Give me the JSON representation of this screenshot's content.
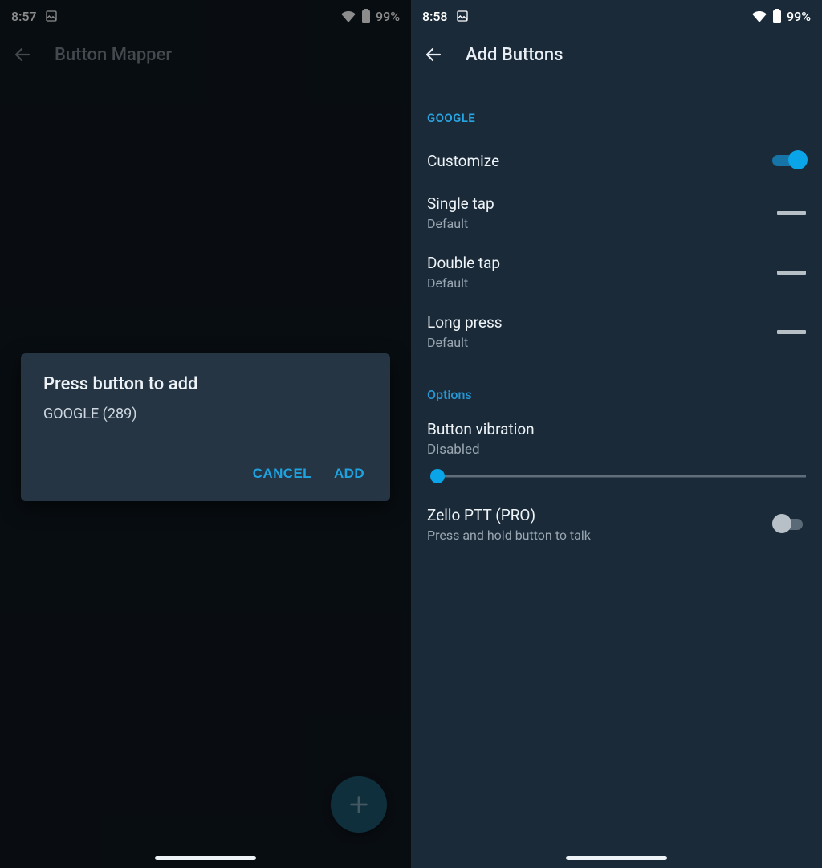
{
  "left": {
    "status": {
      "time": "8:57",
      "battery": "99%"
    },
    "appbar": {
      "title": "Button Mapper"
    },
    "dialog": {
      "title": "Press button to add",
      "detected": "GOOGLE (289)",
      "cancel": "CANCEL",
      "add": "ADD"
    }
  },
  "right": {
    "status": {
      "time": "8:58",
      "battery": "99%"
    },
    "appbar": {
      "title": "Add Buttons"
    },
    "section_google": "GOOGLE",
    "customize": {
      "label": "Customize"
    },
    "single_tap": {
      "label": "Single tap",
      "value": "Default"
    },
    "double_tap": {
      "label": "Double tap",
      "value": "Default"
    },
    "long_press": {
      "label": "Long press",
      "value": "Default"
    },
    "section_options": "Options",
    "vibration": {
      "label": "Button vibration",
      "value": "Disabled"
    },
    "zello": {
      "label": "Zello PTT (PRO)",
      "desc": "Press and hold button to talk"
    }
  }
}
